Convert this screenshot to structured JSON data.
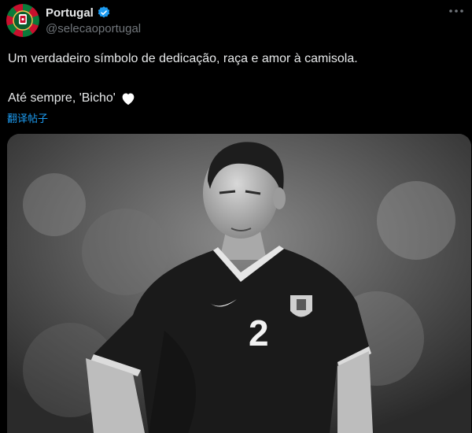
{
  "account": {
    "display_name": "Portugal",
    "handle": "@selecaoportugal",
    "verified": true
  },
  "tweet": {
    "line1": "Um verdadeiro símbolo de dedicação, raça e amor à camisola.",
    "line2": "Até sempre, 'Bicho'",
    "emoji": "white-heart-icon"
  },
  "translate_label": "翻译帖子",
  "media": {
    "description_icon": "photo-football-player",
    "jersey_number": "2"
  },
  "colors": {
    "background": "#000000",
    "text": "#e7e9ea",
    "secondary": "#71767b",
    "link": "#1d9bf0",
    "verified": "#1d9bf0"
  }
}
